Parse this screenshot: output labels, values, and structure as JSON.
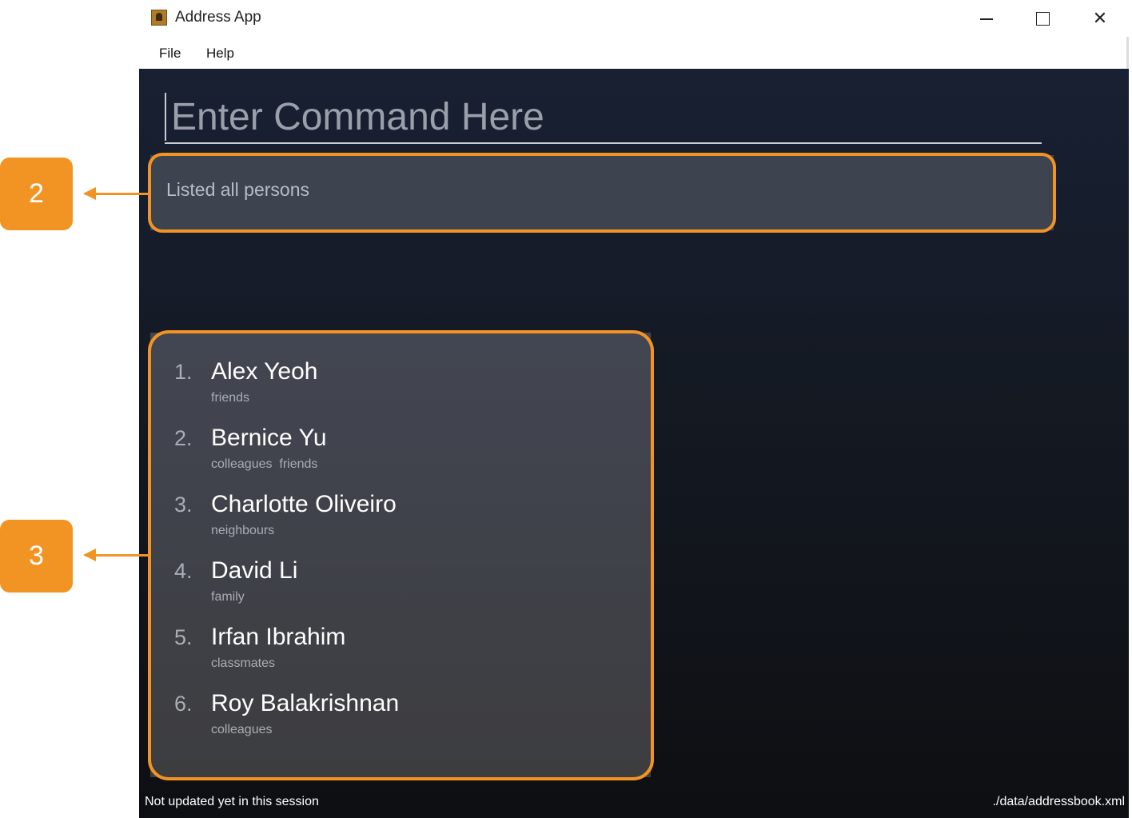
{
  "window": {
    "title": "Address App",
    "controls": {
      "minimize": "minimize",
      "maximize": "maximize",
      "close": "✕"
    }
  },
  "menu": {
    "items": [
      "File",
      "Help"
    ]
  },
  "command": {
    "placeholder": "Enter Command Here",
    "value": ""
  },
  "result": {
    "text": "Listed all persons"
  },
  "persons": [
    {
      "index": "1.",
      "name": "Alex Yeoh",
      "tags": "friends"
    },
    {
      "index": "2.",
      "name": "Bernice Yu",
      "tags": "colleagues  friends"
    },
    {
      "index": "3.",
      "name": "Charlotte Oliveiro",
      "tags": "neighbours"
    },
    {
      "index": "4.",
      "name": "David Li",
      "tags": "family"
    },
    {
      "index": "5.",
      "name": "Irfan Ibrahim",
      "tags": "classmates"
    },
    {
      "index": "6.",
      "name": "Roy Balakrishnan",
      "tags": "colleagues"
    }
  ],
  "status": {
    "sync": "Not updated yet in this session",
    "path": "./data/addressbook.xml"
  },
  "annotations": {
    "callouts": [
      "2",
      "3"
    ],
    "color": "#f29423"
  },
  "icons": {
    "app": "address-book-icon"
  }
}
